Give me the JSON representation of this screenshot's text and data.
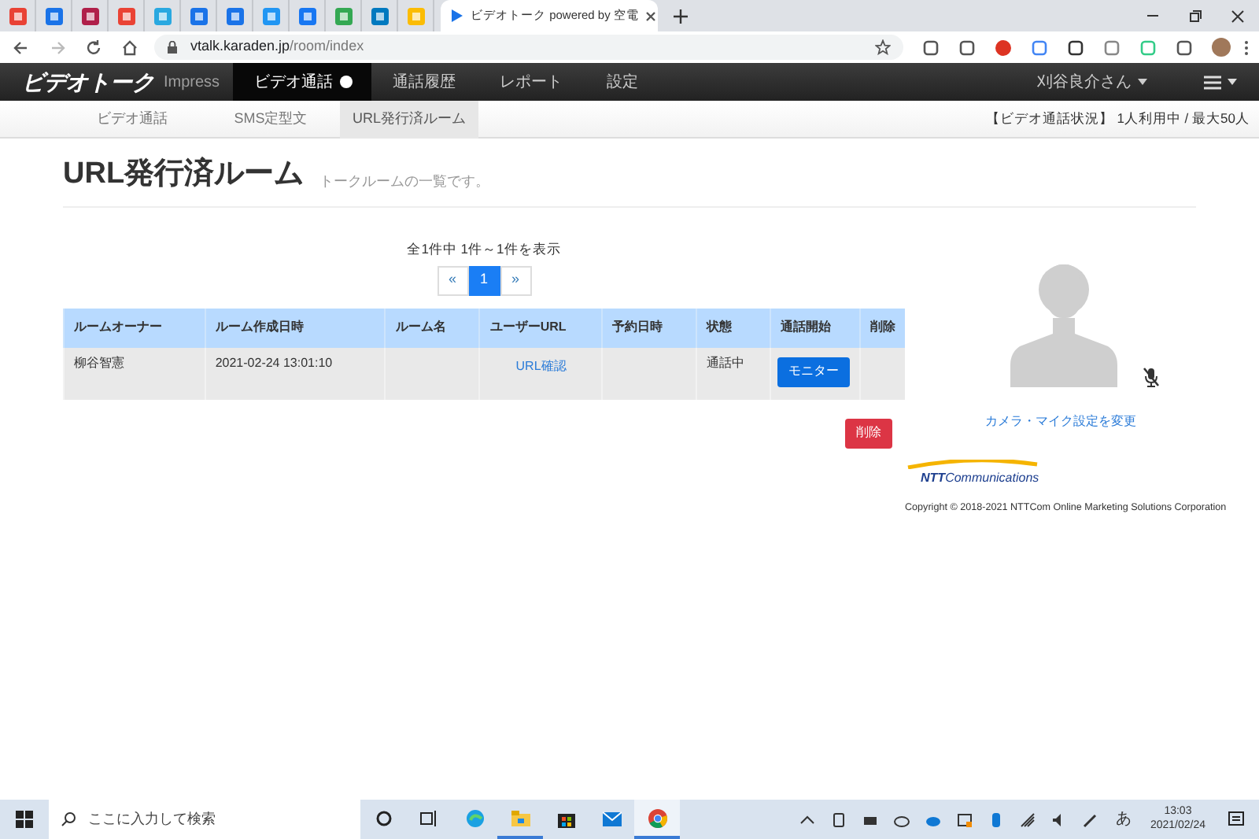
{
  "browser": {
    "tab_title": "ビデオトーク powered by 空電",
    "url_host": "vtalk.karaden.jp",
    "url_path": "/room/index"
  },
  "navbar": {
    "brand": "ビデオトーク",
    "sub_brand": "Impress",
    "user": "刈谷良介さん",
    "items": [
      {
        "label": "ビデオ通話",
        "selected": true,
        "indicator": true
      },
      {
        "label": "通話履歴",
        "selected": false,
        "indicator": false
      },
      {
        "label": "レポート",
        "selected": false,
        "indicator": false
      },
      {
        "label": "設定",
        "selected": false,
        "indicator": false
      }
    ]
  },
  "subnav": {
    "items": [
      {
        "label": "ビデオ通話",
        "selected": false
      },
      {
        "label": "SMS定型文",
        "selected": false
      },
      {
        "label": "URL発行済ルーム",
        "selected": true
      }
    ],
    "status": "【ビデオ通話状況】 1人利用中 / 最大50人"
  },
  "page": {
    "title": "URL発行済ルーム",
    "subtitle": "トークルームの一覧です。"
  },
  "pagination": {
    "summary": "全1件中 1件～1件を表示",
    "prev": "«",
    "next": "»",
    "pages": [
      {
        "label": "1",
        "selected": true
      }
    ]
  },
  "table": {
    "columns": [
      "ルームオーナー",
      "ルーム作成日時",
      "ルーム名",
      "ユーザーURL",
      "予約日時",
      "状態",
      "通話開始",
      "削除"
    ],
    "rows": [
      {
        "cells": [
          {
            "kind": "text",
            "text": "柳谷智憲"
          },
          {
            "kind": "text",
            "text": "2021-02-24 13:01:10"
          },
          {
            "kind": "blank"
          },
          {
            "kind": "link",
            "text": "URL確認"
          },
          {
            "kind": "blank"
          },
          {
            "kind": "text",
            "text": "通話中"
          },
          {
            "kind": "button",
            "text": "モニター"
          },
          {
            "kind": "blank"
          }
        ]
      }
    ]
  },
  "delete_button": "削除",
  "camera": {
    "mic_muted": true,
    "settings_link": "カメラ・マイク設定を変更"
  },
  "footer": {
    "logo_text": "**NTT**Communications",
    "copyright": "Copyright © 2018-2021 NTTCom Online Marketing Solutions Corporation"
  },
  "taskbar": {
    "search_placeholder": "ここに入力して検索",
    "apps": [
      {
        "kind": "edge",
        "running": false,
        "active": false
      },
      {
        "kind": "explorer",
        "running": true,
        "active": false
      },
      {
        "kind": "store",
        "running": false,
        "active": false
      },
      {
        "kind": "mail",
        "running": false,
        "active": false
      },
      {
        "kind": "chrome",
        "running": true,
        "active": true
      }
    ],
    "ime": "あ",
    "time": "13:03",
    "date": "2021/02/24"
  }
}
